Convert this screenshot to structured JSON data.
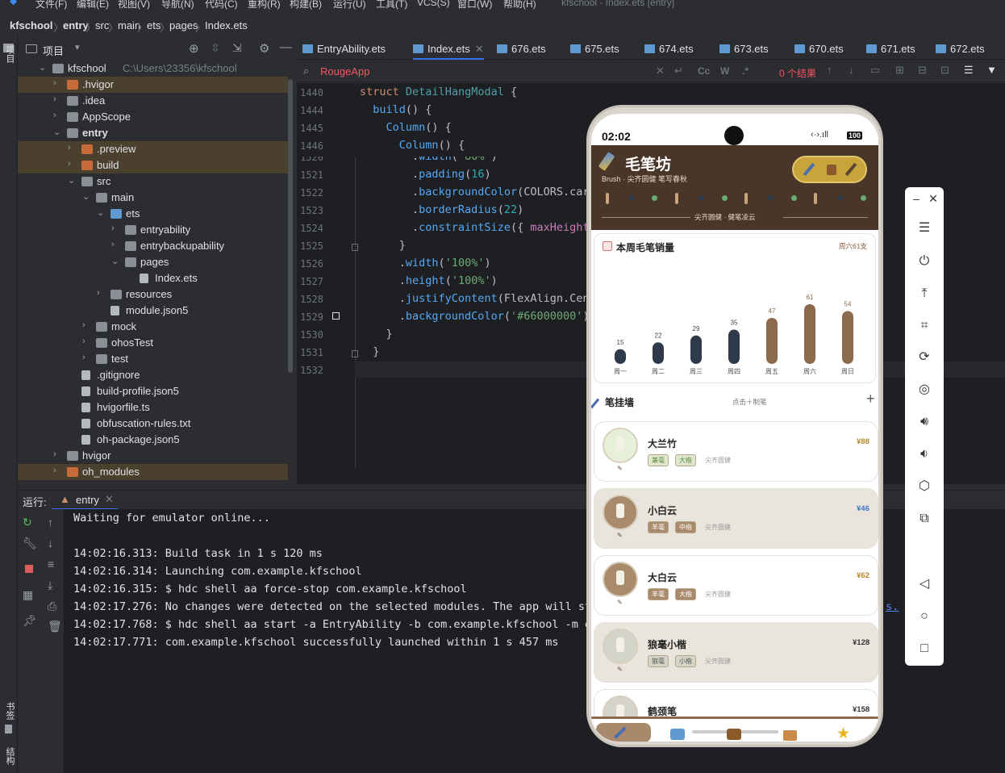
{
  "menu": {
    "items": [
      "文件(F)",
      "编辑(E)",
      "视图(V)",
      "导航(N)",
      "代码(C)",
      "重构(R)",
      "构建(B)",
      "运行(U)",
      "工具(T)",
      "VCS(S)",
      "窗口(W)",
      "帮助(H)"
    ],
    "window_title": "kfschool - Index.ets [entry]"
  },
  "breadcrumb": {
    "items": [
      "kfschool",
      "entry",
      "src",
      "main",
      "ets",
      "pages",
      "Index.ets"
    ]
  },
  "left_tabs": {
    "project": "项目",
    "bookmarks": "书签",
    "structure": "结构"
  },
  "project_panel": {
    "title": "项目"
  },
  "tree": [
    {
      "label": "kfschool",
      "extra": "C:\\Users\\23356\\kfschool",
      "depth": 0,
      "open": true,
      "kind": "folder"
    },
    {
      "label": ".hvigor",
      "depth": 1,
      "open": false,
      "kind": "folder-orange",
      "hl": true
    },
    {
      "label": ".idea",
      "depth": 1,
      "open": false,
      "kind": "folder"
    },
    {
      "label": "AppScope",
      "depth": 1,
      "open": false,
      "kind": "folder"
    },
    {
      "label": "entry",
      "depth": 1,
      "open": true,
      "kind": "folder",
      "bold": true
    },
    {
      "label": ".preview",
      "depth": 2,
      "open": false,
      "kind": "folder-orange",
      "hl": true
    },
    {
      "label": "build",
      "depth": 2,
      "open": false,
      "kind": "folder-orange",
      "hl": true
    },
    {
      "label": "src",
      "depth": 2,
      "open": true,
      "kind": "folder"
    },
    {
      "label": "main",
      "depth": 3,
      "open": true,
      "kind": "folder"
    },
    {
      "label": "ets",
      "depth": 4,
      "open": true,
      "kind": "folder-blue"
    },
    {
      "label": "entryability",
      "depth": 5,
      "open": false,
      "kind": "folder"
    },
    {
      "label": "entrybackupability",
      "depth": 5,
      "open": false,
      "kind": "folder"
    },
    {
      "label": "pages",
      "depth": 5,
      "open": true,
      "kind": "folder"
    },
    {
      "label": "Index.ets",
      "depth": 6,
      "kind": "file"
    },
    {
      "label": "resources",
      "depth": 4,
      "open": false,
      "kind": "folder"
    },
    {
      "label": "module.json5",
      "depth": 4,
      "kind": "file"
    },
    {
      "label": "mock",
      "depth": 3,
      "open": false,
      "kind": "folder"
    },
    {
      "label": "ohosTest",
      "depth": 3,
      "open": false,
      "kind": "folder"
    },
    {
      "label": "test",
      "depth": 3,
      "open": false,
      "kind": "folder"
    },
    {
      "label": ".gitignore",
      "depth": 2,
      "kind": "file"
    },
    {
      "label": "build-profile.json5",
      "depth": 2,
      "kind": "file"
    },
    {
      "label": "hvigorfile.ts",
      "depth": 2,
      "kind": "file"
    },
    {
      "label": "obfuscation-rules.txt",
      "depth": 2,
      "kind": "file"
    },
    {
      "label": "oh-package.json5",
      "depth": 2,
      "kind": "file"
    },
    {
      "label": "hvigor",
      "depth": 1,
      "open": false,
      "kind": "folder"
    },
    {
      "label": "oh_modules",
      "depth": 1,
      "open": false,
      "kind": "folder-orange",
      "hl": true
    }
  ],
  "tabs": [
    {
      "label": "EntryAbility.ets",
      "active": false
    },
    {
      "label": "Index.ets",
      "active": true
    },
    {
      "label": "676.ets",
      "active": false
    },
    {
      "label": "675.ets",
      "active": false
    },
    {
      "label": "674.ets",
      "active": false
    },
    {
      "label": "673.ets",
      "active": false
    },
    {
      "label": "670.ets",
      "active": false
    },
    {
      "label": "671.ets",
      "active": false
    },
    {
      "label": "672.ets",
      "active": false
    }
  ],
  "search": {
    "query": "RougeApp",
    "result": "0 个结果",
    "opts": [
      "Cc",
      "W",
      ".*"
    ]
  },
  "editor": {
    "sticky": [
      {
        "ln": "1440",
        "code": "struct DetailHangModal {"
      },
      {
        "ln": "1444",
        "code": "  build() {"
      },
      {
        "ln": "1445",
        "code": "    Column() {"
      },
      {
        "ln": "1446",
        "code": "      Column() {"
      }
    ],
    "lines": [
      {
        "ln": "1520",
        "code": "        .width('80%')"
      },
      {
        "ln": "1521",
        "code": "        .padding(16)"
      },
      {
        "ln": "1522",
        "code": "        .backgroundColor(COLORS.cardB"
      },
      {
        "ln": "1523",
        "code": "        .borderRadius(22)"
      },
      {
        "ln": "1524",
        "code": "        .constraintSize({ maxHeight: "
      },
      {
        "ln": "1525",
        "code": "      }"
      },
      {
        "ln": "1526",
        "code": "      .width('100%')"
      },
      {
        "ln": "1527",
        "code": "      .height('100%')"
      },
      {
        "ln": "1528",
        "code": "      .justifyContent(FlexAlign.Cente"
      },
      {
        "ln": "1529",
        "code": "      .backgroundColor('#66000000')"
      },
      {
        "ln": "1530",
        "code": "    }"
      },
      {
        "ln": "1531",
        "code": "  }"
      },
      {
        "ln": "1532",
        "code": ""
      }
    ]
  },
  "run": {
    "label": "运行:",
    "config": "entry"
  },
  "console": [
    "Waiting for emulator online...",
    "",
    "14:02:16.313: Build task in 1 s 120 ms",
    "14:02:16.314: Launching com.example.kfschool",
    "14:02:16.315: $ hdc shell aa force-stop com.example.kfschool",
    "14:02:17.276: No changes were detected on the selected modules. The app will st",
    "14:02:17.768: $ hdc shell aa start -a EntryAbility -b com.example.kfschool -m e",
    "14:02:17.771: com.example.kfschool successfully launched within 1 s 457 ms"
  ],
  "console_link": "s.",
  "phone": {
    "time": "02:02",
    "battery": "100",
    "app_title": "毛笔坊",
    "app_sub": "Brush · 尖齐圆健 笔写春秋",
    "divider_text": "尖齐圆健 · 健笔凌云",
    "weekly": {
      "title": "本周毛笔销量",
      "note": "周六61支"
    },
    "wall": {
      "title": "笔挂墙",
      "hint": "点击＋制笔",
      "add": "+"
    },
    "brushes": [
      {
        "name": "大兰竹",
        "price": "¥88",
        "tags": [
          "兼毫",
          "大楷"
        ],
        "desc": "尖齐圆健",
        "tint": "#e8efd8",
        "card": "#ffffff",
        "price_color": "#b7862a",
        "tag_color": "#5d8a3c",
        "tag_bg": "#dfe8cf"
      },
      {
        "name": "小白云",
        "price": "¥46",
        "tags": [
          "羊毫",
          "中楷"
        ],
        "desc": "尖齐圆健",
        "tint": "#a98a6a",
        "card": "#e9e4dc",
        "price_color": "#3f78c4",
        "tag_color": "#ffffff",
        "tag_bg": "#a98a6a"
      },
      {
        "name": "大白云",
        "price": "¥62",
        "tags": [
          "羊毫",
          "大楷"
        ],
        "desc": "尖齐圆健",
        "tint": "#a98a6a",
        "card": "#ffffff",
        "price_color": "#b7862a",
        "tag_color": "#ffffff",
        "tag_bg": "#a98a6a"
      },
      {
        "name": "狼毫小楷",
        "price": "¥128",
        "tags": [
          "狼毫",
          "小楷"
        ],
        "desc": "尖齐圆健",
        "tint": "#d5d4c8",
        "card": "#e9e4dc",
        "price_color": "#333333",
        "tag_color": "#555555",
        "tag_bg": "#d5d4c8"
      },
      {
        "name": "鹤颈笔",
        "price": "¥158",
        "tags": [],
        "desc": "",
        "tint": "#d5d4c8",
        "card": "#ffffff",
        "price_color": "#333333",
        "tag_color": "#555555",
        "tag_bg": "#d5d4c8"
      }
    ],
    "colors": {
      "header": "#4a3628",
      "accent": "#c9a43a",
      "bar_dark": "#2e3a4a",
      "bar_brown": "#8b6a4e"
    }
  },
  "chart_data": {
    "type": "bar",
    "title": "本周毛笔销量",
    "categories": [
      "周一",
      "周二",
      "周三",
      "周四",
      "周五",
      "周六",
      "周日"
    ],
    "values": [
      15,
      22,
      29,
      35,
      47,
      61,
      54
    ],
    "colors": [
      "#2e3a4a",
      "#2e3a4a",
      "#2e3a4a",
      "#2e3a4a",
      "#8b6a4e",
      "#8b6a4e",
      "#8b6a4e"
    ]
  }
}
